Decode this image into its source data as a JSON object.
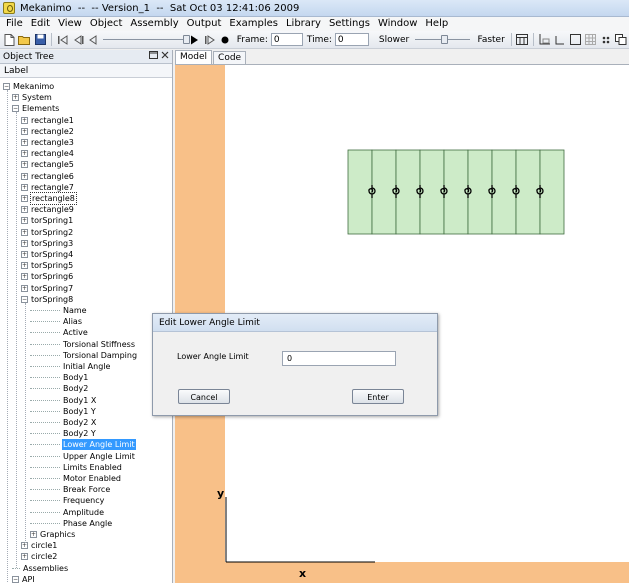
{
  "window": {
    "title": "Mekanimo  --  -- Version_1  --  Sat Oct 03 12:41:06 2009"
  },
  "menu": [
    "File",
    "Edit",
    "View",
    "Object",
    "Assembly",
    "Output",
    "Examples",
    "Library",
    "Settings",
    "Window",
    "Help"
  ],
  "toolbar": {
    "frame_label": "Frame:",
    "frame_value": "0",
    "time_label": "Time:",
    "time_value": "0",
    "slower_label": "Slower",
    "faster_label": "Faster"
  },
  "tree": {
    "title": "Object Tree",
    "column": "Label",
    "items": [
      {
        "label": "Mekanimo",
        "level": 0,
        "expander": "minus"
      },
      {
        "label": "System",
        "level": 1,
        "expander": "plus"
      },
      {
        "label": "Elements",
        "level": 1,
        "expander": "minus"
      },
      {
        "label": "rectangle1",
        "level": 2,
        "expander": "plus"
      },
      {
        "label": "rectangle2",
        "level": 2,
        "expander": "plus"
      },
      {
        "label": "rectangle3",
        "level": 2,
        "expander": "plus"
      },
      {
        "label": "rectangle4",
        "level": 2,
        "expander": "plus"
      },
      {
        "label": "rectangle5",
        "level": 2,
        "expander": "plus"
      },
      {
        "label": "rectangle6",
        "level": 2,
        "expander": "plus"
      },
      {
        "label": "rectangle7",
        "level": 2,
        "expander": "plus"
      },
      {
        "label": "rectangle8",
        "level": 2,
        "expander": "plus",
        "state": "focused"
      },
      {
        "label": "rectangle9",
        "level": 2,
        "expander": "plus"
      },
      {
        "label": "torSpring1",
        "level": 2,
        "expander": "plus"
      },
      {
        "label": "torSpring2",
        "level": 2,
        "expander": "plus"
      },
      {
        "label": "torSpring3",
        "level": 2,
        "expander": "plus"
      },
      {
        "label": "torSpring4",
        "level": 2,
        "expander": "plus"
      },
      {
        "label": "torSpring5",
        "level": 2,
        "expander": "plus"
      },
      {
        "label": "torSpring6",
        "level": 2,
        "expander": "plus"
      },
      {
        "label": "torSpring7",
        "level": 2,
        "expander": "plus"
      },
      {
        "label": "torSpring8",
        "level": 2,
        "expander": "minus"
      },
      {
        "label": "Name",
        "level": 3
      },
      {
        "label": "Alias",
        "level": 3
      },
      {
        "label": "Active",
        "level": 3
      },
      {
        "label": "Torsional Stiffness",
        "level": 3
      },
      {
        "label": "Torsional Damping",
        "level": 3
      },
      {
        "label": "Initial Angle",
        "level": 3
      },
      {
        "label": "Body1",
        "level": 3
      },
      {
        "label": "Body2",
        "level": 3
      },
      {
        "label": "Body1 X",
        "level": 3
      },
      {
        "label": "Body1 Y",
        "level": 3
      },
      {
        "label": "Body2 X",
        "level": 3
      },
      {
        "label": "Body2 Y",
        "level": 3
      },
      {
        "label": "Lower Angle Limit",
        "level": 3,
        "state": "selected"
      },
      {
        "label": "Upper Angle Limit",
        "level": 3
      },
      {
        "label": "Limits Enabled",
        "level": 3
      },
      {
        "label": "Motor Enabled",
        "level": 3
      },
      {
        "label": "Break Force",
        "level": 3
      },
      {
        "label": "Frequency",
        "level": 3
      },
      {
        "label": "Amplitude",
        "level": 3
      },
      {
        "label": "Phase Angle",
        "level": 3
      },
      {
        "label": "Graphics",
        "level": 3,
        "expander": "plus"
      },
      {
        "label": "circle1",
        "level": 2,
        "expander": "plus"
      },
      {
        "label": "circle2",
        "level": 2,
        "expander": "plus"
      },
      {
        "label": "Assemblies",
        "level": 1
      },
      {
        "label": "API",
        "level": 1,
        "expander": "minus"
      }
    ]
  },
  "tabs": [
    "Model",
    "Code"
  ],
  "canvas": {
    "axis_x_label": "x",
    "axis_y_label": "y",
    "rectangle_count": 9,
    "spring_count": 8,
    "ground_color": "#f8c088",
    "rectangle_color": "#cdebc8",
    "rectangle_border": "#3f6b3f"
  },
  "dialog": {
    "title": "Edit Lower Angle Limit",
    "field_label": "Lower Angle Limit",
    "field_value": "0",
    "cancel_label": "Cancel",
    "enter_label": "Enter"
  }
}
